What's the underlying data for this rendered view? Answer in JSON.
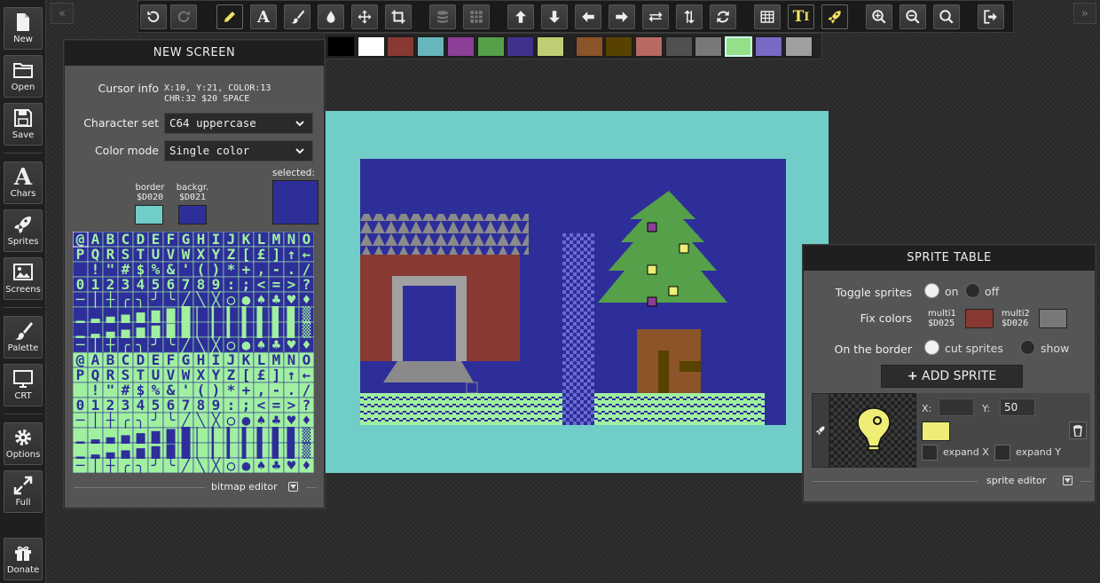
{
  "sidebar": {
    "new": "New",
    "open": "Open",
    "save": "Save",
    "chars": "Chars",
    "sprites": "Sprites",
    "screens": "Screens",
    "palette": "Palette",
    "crt": "CRT",
    "options": "Options",
    "full": "Full",
    "donate": "Donate"
  },
  "toolbar": {
    "text_tool_glyph": "A",
    "text_mode_glyph": "T",
    "text_mode_sub": "I"
  },
  "palette_colors": [
    "#000000",
    "#ffffff",
    "#883932",
    "#67b6bd",
    "#8b3f96",
    "#55a049",
    "#40318d",
    "#bfce72",
    "#8b5429",
    "#574200",
    "#b86962",
    "#505050",
    "#787878",
    "#94e089",
    "#7869c4",
    "#9f9f9f"
  ],
  "screen_panel": {
    "title": "NEW SCREEN",
    "cursor_label": "Cursor info",
    "cursor_line1": "X:10, Y:21, COLOR:13",
    "cursor_line2": "CHR:32 $20 SPACE",
    "charset_label": "Character set",
    "charset_value": "C64 uppercase",
    "colormode_label": "Color mode",
    "colormode_value": "Single color",
    "border_label": "border",
    "border_addr": "$D020",
    "border_color": "#70cdc7",
    "background_label": "backgr.",
    "background_addr": "$D021",
    "background_color": "#2e2e9a",
    "selected_label": "selected:",
    "selected_color": "#2e2e9a",
    "footer": "bitmap editor"
  },
  "charset": {
    "row1": "@ABCDEFGHIJKLMNO",
    "row2": "PQRSTUVWXYZ[£]↑←",
    "row3": " !\"#$%&'()*+,-./",
    "row4": "0123456789:;<=>?"
  },
  "sprite_panel": {
    "title": "SPRITE TABLE",
    "toggle_label": "Toggle sprites",
    "on_label": "on",
    "off_label": "off",
    "fix_label": "Fix colors",
    "multi1_label": "multi1",
    "multi1_addr": "$D025",
    "multi1_color": "#883932",
    "multi2_label": "multi2",
    "multi2_addr": "$D026",
    "multi2_color": "#787878",
    "border_label": "On the border",
    "cut_label": "cut sprites",
    "show_label": "show",
    "add_label": "ADD SPRITE",
    "x_label": "X:",
    "x_value": "",
    "y_label": "Y:",
    "y_value": "50",
    "sprite_color": "#eeee77",
    "expand_x": "expand X",
    "expand_y": "expand Y",
    "footer": "sprite editor"
  },
  "icons": [
    "undo-icon",
    "redo-icon",
    "pencil-icon",
    "text-icon",
    "brush-icon",
    "fill-icon",
    "move-icon",
    "crop-icon",
    "layers-icon",
    "grid-icon",
    "arrow-up-icon",
    "arrow-down-icon",
    "arrow-left-icon",
    "arrow-right-icon",
    "flip-h-icon",
    "flip-v-icon",
    "rotate-icon",
    "table-icon",
    "text-mode-icon",
    "rocket-icon",
    "zoom-in-icon",
    "zoom-out-icon",
    "zoom-fit-icon",
    "export-icon"
  ]
}
